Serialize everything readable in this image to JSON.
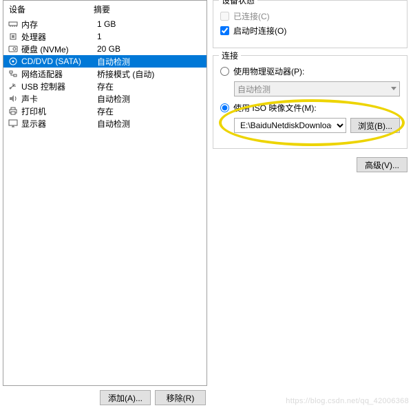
{
  "left": {
    "header_device": "设备",
    "header_summary": "摘要",
    "rows": [
      {
        "icon": "memory-icon",
        "name": "内存",
        "summary": "1 GB"
      },
      {
        "icon": "cpu-icon",
        "name": "处理器",
        "summary": "1"
      },
      {
        "icon": "disk-icon",
        "name": "硬盘 (NVMe)",
        "summary": "20 GB"
      },
      {
        "icon": "cd-icon",
        "name": "CD/DVD (SATA)",
        "summary": "自动检测",
        "selected": true
      },
      {
        "icon": "network-icon",
        "name": "网络适配器",
        "summary": "桥接模式 (自动)"
      },
      {
        "icon": "usb-icon",
        "name": "USB 控制器",
        "summary": "存在"
      },
      {
        "icon": "sound-icon",
        "name": "声卡",
        "summary": "自动检测"
      },
      {
        "icon": "printer-icon",
        "name": "打印机",
        "summary": "存在"
      },
      {
        "icon": "display-icon",
        "name": "显示器",
        "summary": "自动检测"
      }
    ],
    "add_label": "添加(A)...",
    "remove_label": "移除(R)"
  },
  "right": {
    "status_legend": "设备状态",
    "connected_label": "已连接(C)",
    "connect_on_start_label": "启动时连接(O)",
    "connect_legend": "连接",
    "use_physical_label": "使用物理驱动器(P):",
    "physical_value": "自动检测",
    "use_iso_label": "使用 ISO 映像文件(M):",
    "iso_path": "E:\\BaiduNetdiskDownload\\rhel-",
    "browse_label": "浏览(B)...",
    "advanced_label": "高级(V)..."
  },
  "watermark": "https://blog.csdn.net/qq_42006368"
}
